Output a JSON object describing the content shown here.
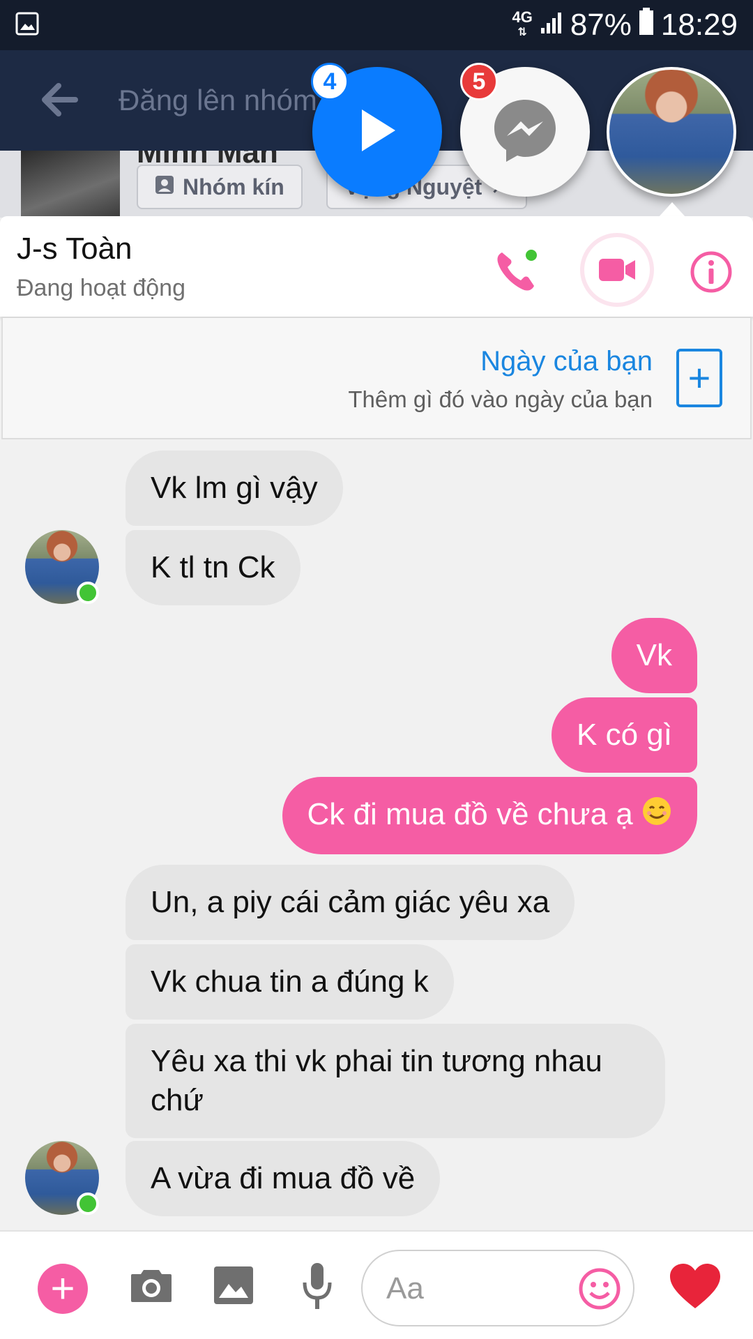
{
  "status_bar": {
    "network": "4G",
    "battery": "87%",
    "time": "18:29"
  },
  "background_app": {
    "title": "Đăng lên nhóm",
    "group_name_partial": "Minh Mẫn",
    "chip_private": "Nhóm kín",
    "chip_member": "Vọng Nguyệt"
  },
  "chat_heads": {
    "play_badge": "4",
    "messenger_badge": "5"
  },
  "chat_header": {
    "contact_name": "J-s Toàn",
    "status": "Đang hoạt động"
  },
  "story_prompt": {
    "title": "Ngày của bạn",
    "subtitle": "Thêm gì đó vào ngày của bạn",
    "add_symbol": "+"
  },
  "messages": {
    "m1": "Vk lm gì vậy",
    "m2": "K tl tn Ck",
    "m3": "Vk",
    "m4": "K có gì",
    "m5": "Ck đi mua đồ về chưa ạ",
    "m6": "Un, a piy cái cảm giác yêu xa",
    "m7": "Vk chua tin a đúng k",
    "m8": "Yêu xa thi vk phai tin tương nhau chứ",
    "m9": "A vừa đi mua đồ về"
  },
  "composer": {
    "placeholder": "Aa",
    "plus_symbol": "+"
  },
  "colors": {
    "accent_pink": "#f55da4",
    "messenger_blue": "#0a7cff",
    "online_green": "#42c435",
    "story_blue": "#1a86e0"
  }
}
